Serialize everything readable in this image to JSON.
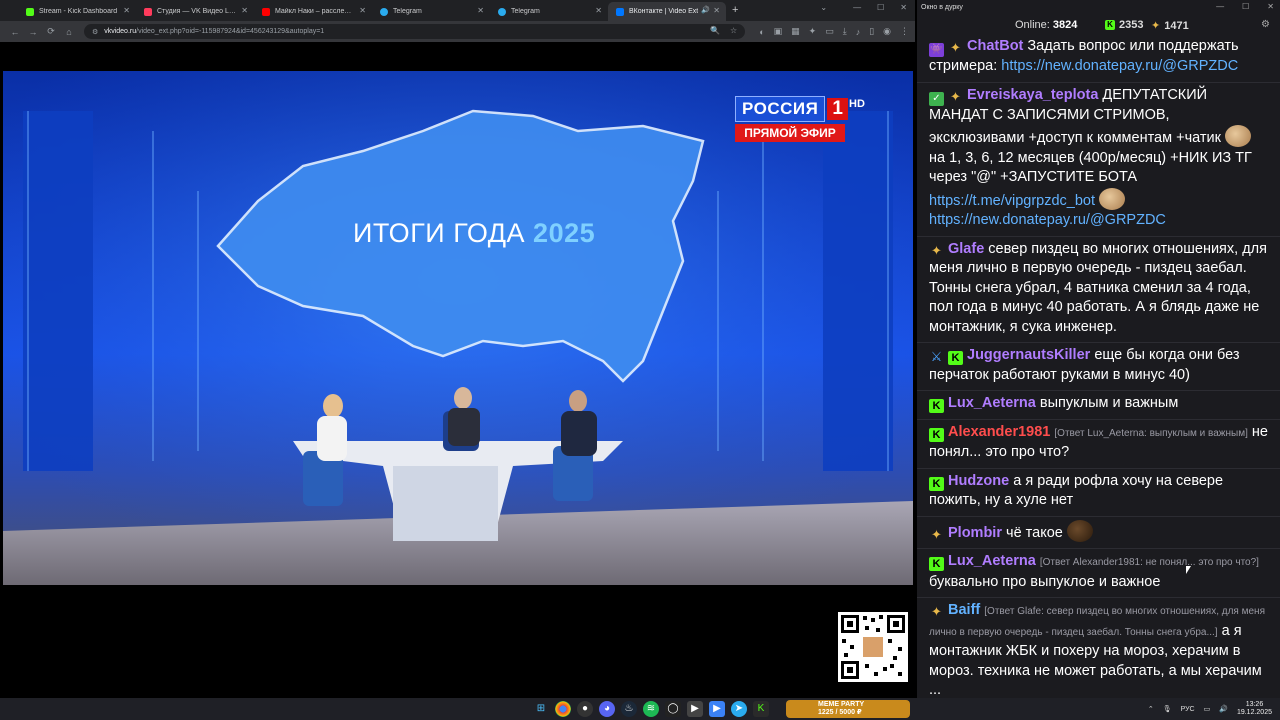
{
  "browser": {
    "tabs": [
      {
        "title": "Stream - Kick Dashboard",
        "color": "#53fc18",
        "active": false
      },
      {
        "title": "Студия — VK Видео Live",
        "color": "#ff3b5c",
        "active": false
      },
      {
        "title": "Майкл Наки – расследования",
        "color": "#ff0000",
        "active": false
      },
      {
        "title": "Telegram",
        "color": "#2aabee",
        "active": false
      },
      {
        "title": "Telegram",
        "color": "#2aabee",
        "active": false
      },
      {
        "title": "ВКонтакте | Video Ext",
        "color": "#0077ff",
        "active": true
      }
    ],
    "new_tab_label": "+",
    "url_host": "vkvideo.ru",
    "url_path": "/video_ext.php?oid=-115987924&id=456243129&autoplay=1"
  },
  "video": {
    "channel_logo": "РОССИЯ",
    "channel_number": "1",
    "hd_label": "HD",
    "live_label": "ПРЯМОЙ ЭФИР",
    "title_text": "ИТОГИ ГОДА",
    "title_year": "2025"
  },
  "chat": {
    "window_title": "Окно в дурку",
    "online_label": "Online:",
    "online_count": "3824",
    "kick_count": "2353",
    "vk_count": "1471",
    "messages": [
      {
        "user": "ChatBot",
        "user_color": "#b07dff",
        "badge": "bot",
        "reply": "",
        "text": "Задать вопрос или поддержать стримера:",
        "link": "https://new.donatepay.ru/@GRPZDC"
      },
      {
        "user": "Evreiskaya_teplota",
        "user_color": "#b07dff",
        "badge": "green",
        "reply": "",
        "text": "ДЕПУТАТСКИЙ МАНДАТ С ЗАПИСЯМИ СТРИМОВ, эксклюзивами +доступ к комментам +чатик",
        "text2": "на 1, 3, 6, 12 месяцев (400р/месяц) +НИК ИЗ ТГ через \"@\" +ЗАПУСТИТЕ БОТА",
        "link": "https://t.me/vipgrpzdc_bot",
        "link2": "https://new.donatepay.ru/@GRPZDC"
      },
      {
        "user": "Glafe",
        "user_color": "#b07dff",
        "badge": "gold",
        "reply": "",
        "text": "север пиздец во многих отношениях, для меня лично в первую очередь - пиздец заебал. Тонны снега убрал, 4 ватника сменил за 4 года, пол года в минус 40 работать. А я блядь даже не монтажник, я сука инженер."
      },
      {
        "user": "JuggernautsKiller",
        "user_color": "#b07dff",
        "badge": "sword",
        "reply": "",
        "text": "еще бы когда они без перчаток работают руками в минус 40)"
      },
      {
        "user": "Lux_Aeterna",
        "user_color": "#b07dff",
        "badge": "kick",
        "reply": "",
        "text": "выпуклым и важным"
      },
      {
        "user": "Alexander1981",
        "user_color": "#ff4d4d",
        "badge": "kick",
        "reply": "[Ответ Lux_Aeterna: выпуклым и важным]",
        "text": "не понял... это про что?"
      },
      {
        "user": "Hudzone",
        "user_color": "#b07dff",
        "badge": "kick",
        "reply": "",
        "text": "а я ради рофла хочу на севере пожить, ну а хуле нет"
      },
      {
        "user": "Plombir",
        "user_color": "#b07dff",
        "badge": "gold",
        "reply": "",
        "text": "чё такое"
      },
      {
        "user": "Lux_Aeterna",
        "user_color": "#b07dff",
        "badge": "kick",
        "reply": "[Ответ Alexander1981: не понял... это про что?]",
        "text": "буквально про выпуклое и важное"
      },
      {
        "user": "Baiff",
        "user_color": "#62b2ff",
        "badge": "gold",
        "reply": "[Ответ Glafe: север пиздец во многих отношениях, для меня лично в первую очередь - пиздец заебал. Тонны снега убра...]",
        "text": "а я монтажник ЖБК и похеру на мороз, херачим в мороз. техника не может работать, а мы херачим ..."
      }
    ]
  },
  "taskbar": {
    "widget_title": "MEME PARTY",
    "widget_amount": "1225 / 5000 ₽",
    "lang": "РУС",
    "time": "13:26",
    "date": "19.12.2025"
  }
}
